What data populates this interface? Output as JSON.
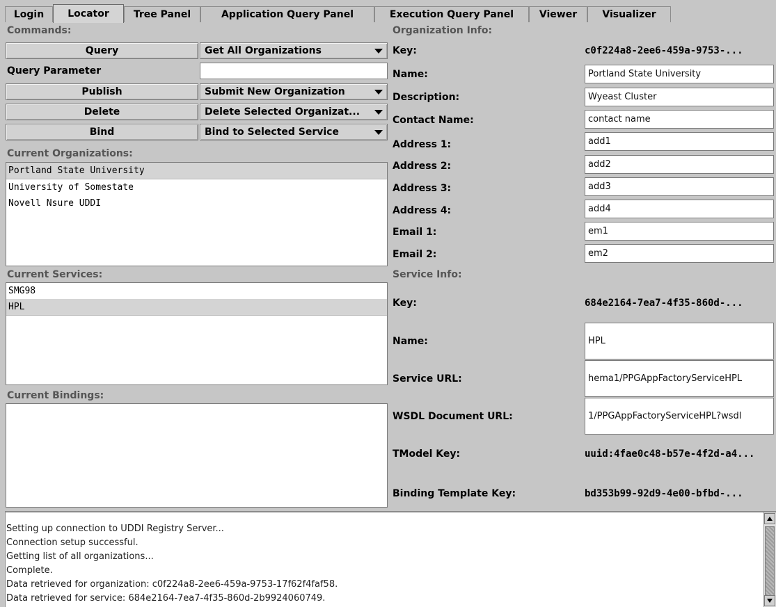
{
  "tabs": [
    "Login",
    "Locator",
    "Tree Panel",
    "Application Query Panel",
    "Execution Query Panel",
    "Viewer",
    "Visualizer"
  ],
  "active_tab": "Locator",
  "commands": {
    "label": "Commands:",
    "query_button": "Query",
    "query_select": "Get All Organizations",
    "query_param_label": "Query Parameter",
    "query_param_value": "",
    "publish_button": "Publish",
    "publish_select": "Submit New Organization",
    "delete_button": "Delete",
    "delete_select": "Delete Selected Organizat...",
    "bind_button": "Bind",
    "bind_select": "Bind to Selected Service"
  },
  "organizations": {
    "label": "Current Organizations:",
    "items": [
      "Portland State University",
      "University of Somestate",
      "Novell Nsure UDDI"
    ],
    "selected": 0
  },
  "services": {
    "label": "Current Services:",
    "items": [
      "SMG98",
      "HPL"
    ],
    "selected": 1
  },
  "bindings": {
    "label": "Current Bindings:",
    "items": []
  },
  "org_info": {
    "label": "Organization Info:",
    "key_label": "Key:",
    "key_value": "c0f224a8-2ee6-459a-9753-...",
    "name_label": "Name:",
    "name_value": "Portland State University",
    "description_label": "Description:",
    "description_value": "Wyeast Cluster",
    "contact_label": "Contact Name:",
    "contact_value": "contact name",
    "address1_label": "Address 1:",
    "address1_value": "add1",
    "address2_label": "Address 2:",
    "address2_value": "add2",
    "address3_label": "Address 3:",
    "address3_value": "add3",
    "address4_label": "Address 4:",
    "address4_value": "add4",
    "email1_label": "Email 1:",
    "email1_value": "em1",
    "email2_label": "Email 2:",
    "email2_value": "em2"
  },
  "service_info": {
    "label": "Service Info:",
    "key_label": "Key:",
    "key_value": "684e2164-7ea7-4f35-860d-...",
    "name_label": "Name:",
    "name_value": "HPL",
    "url_label": "Service URL:",
    "url_value": "hema1/PPGAppFactoryServiceHPL",
    "wsdl_label": "WSDL Document URL:",
    "wsdl_value": "1/PPGAppFactoryServiceHPL?wsdl",
    "tmodel_label": "TModel Key:",
    "tmodel_value": "uuid:4fae0c48-b57e-4f2d-a4...",
    "binding_label": "Binding Template Key:",
    "binding_value": "bd353b99-92d9-4e00-bfbd-..."
  },
  "log": [
    "Setting up connection to UDDI Registry Server...",
    "Connection setup successful.",
    "Getting list of all organizations...",
    "Complete.",
    "Data retrieved for organization: c0f224a8-2ee6-459a-9753-17f62f4faf58.",
    "Data retrieved for service: 684e2164-7ea7-4f35-860d-2b9924060749."
  ]
}
